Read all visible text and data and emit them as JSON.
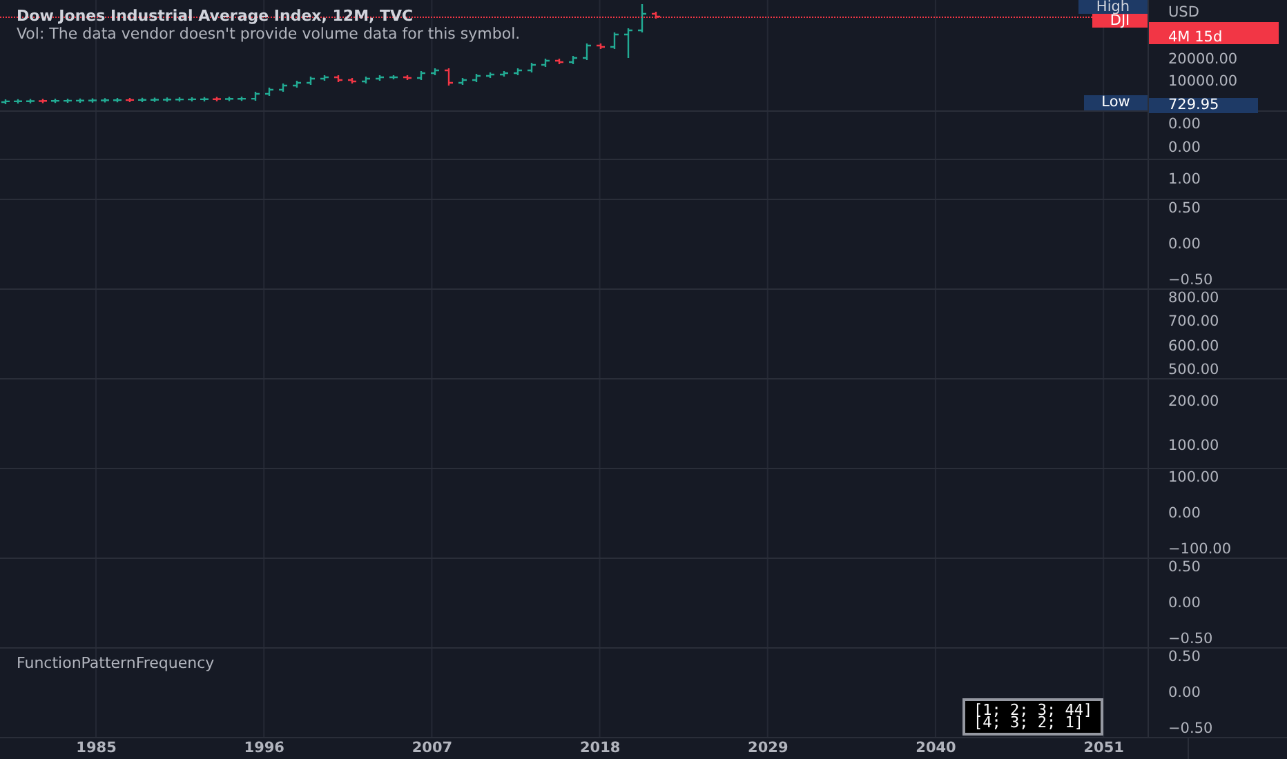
{
  "legend": {
    "title": "Dow Jones Industrial Average Index, 12M, TVC",
    "volume_note": "Vol: The data vendor doesn't provide volume data for this symbol."
  },
  "main_pane": {
    "currency": "USD",
    "high_label": "High",
    "symbol_label": "DJI",
    "countdown": "4M 15d",
    "ticks": [
      "20000.00",
      "10000.00"
    ],
    "low_label": "Low",
    "low_value": "729.95"
  },
  "panes": [
    {
      "ticks": [
        "0.00",
        "0.00"
      ]
    },
    {
      "ticks": [
        "1.00"
      ]
    },
    {
      "ticks": [
        "0.50",
        "0.00",
        "−0.50"
      ]
    },
    {
      "ticks": [
        "800.00",
        "700.00",
        "600.00",
        "500.00"
      ]
    },
    {
      "ticks": [
        "200.00",
        "100.00"
      ]
    },
    {
      "ticks": [
        "100.00",
        "0.00",
        "−100.00"
      ]
    },
    {
      "ticks": [
        "0.50",
        "0.00",
        "−0.50"
      ]
    },
    {
      "ticks": [
        "0.50",
        "0.00",
        "−0.50"
      ],
      "title": "FunctionPatternFrequency",
      "matrix": [
        "[1; 2; 3; 44]",
        "[4; 3; 2; 1]"
      ]
    }
  ],
  "time_axis": [
    "1985",
    "1996",
    "2007",
    "2018",
    "2029",
    "2040",
    "2051"
  ]
}
